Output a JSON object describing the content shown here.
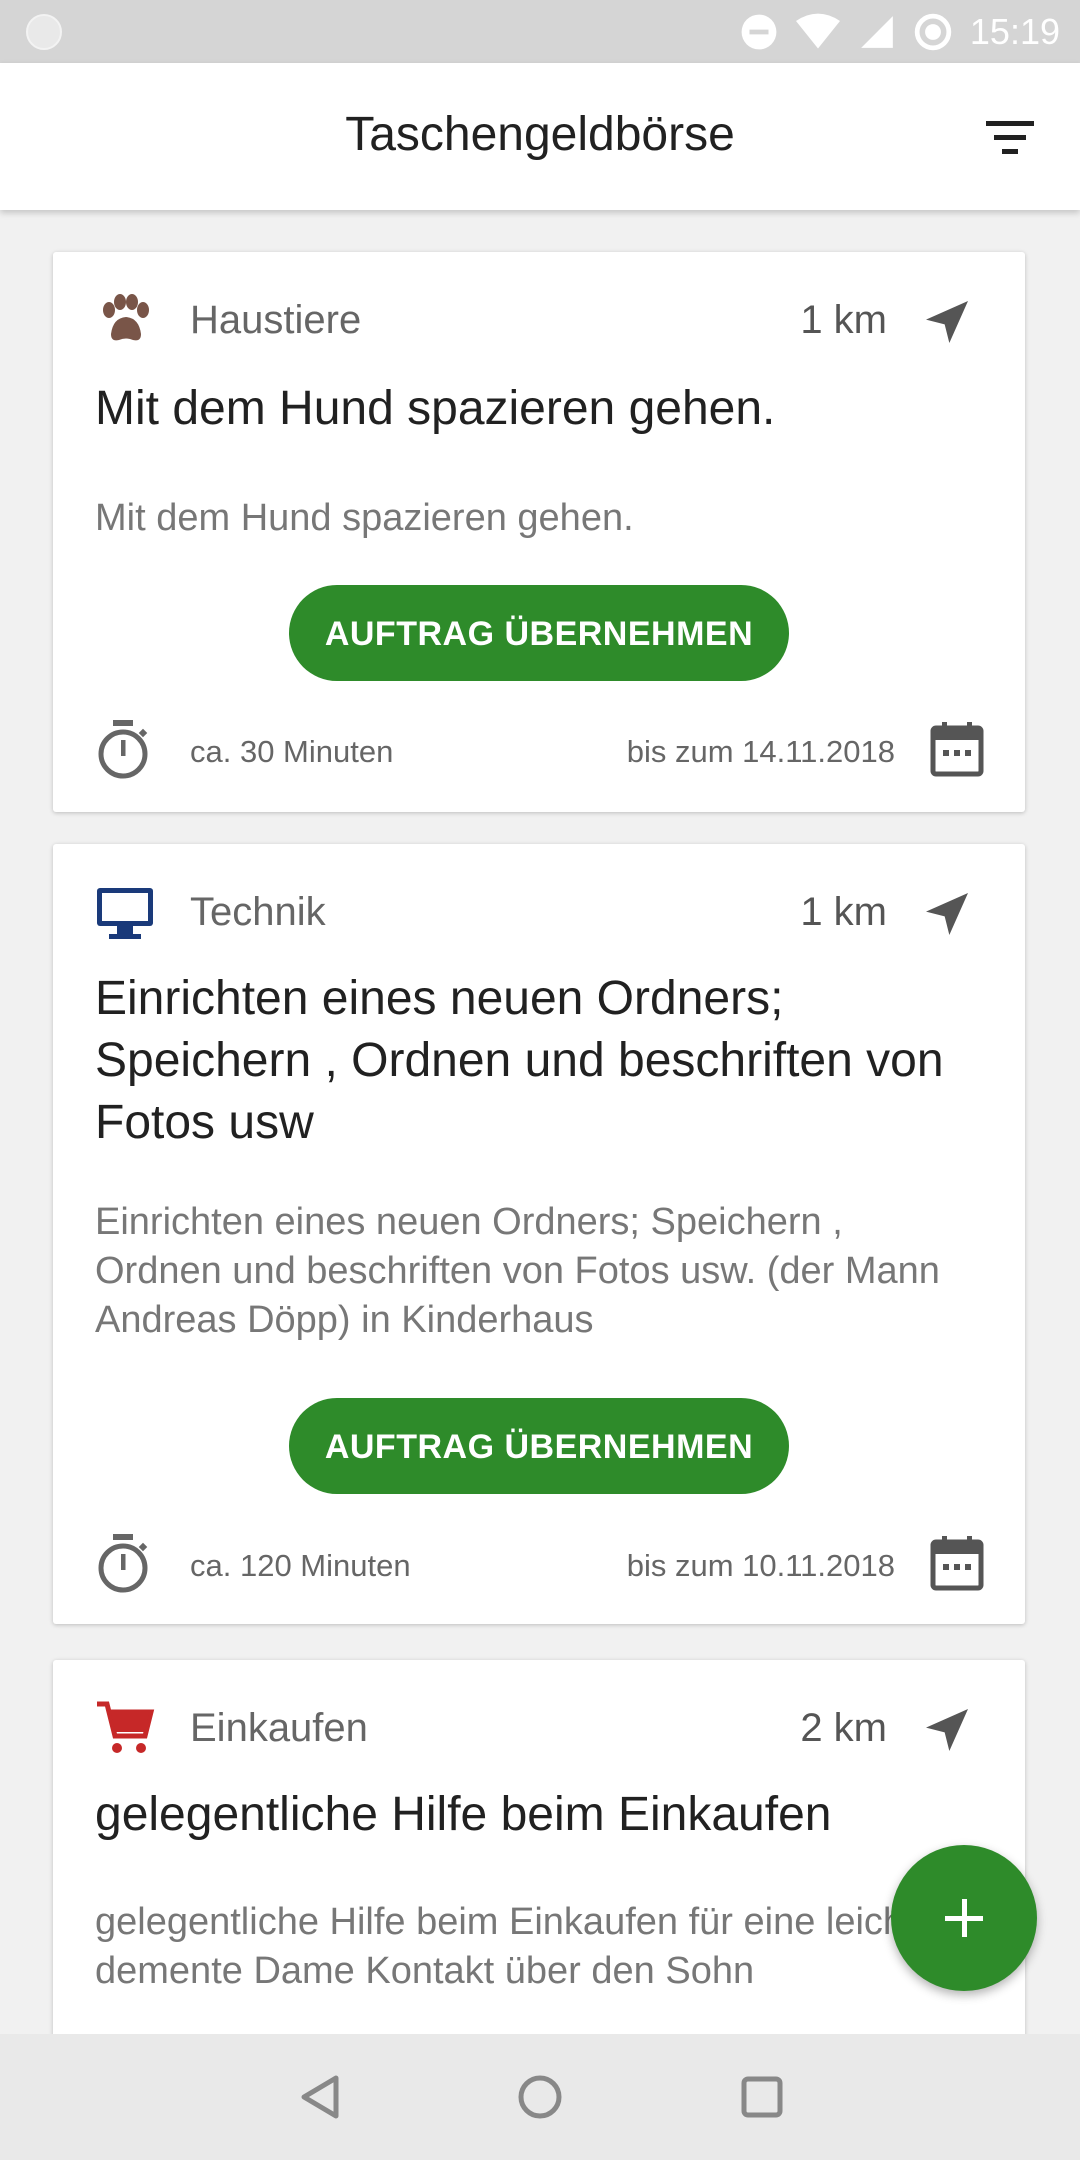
{
  "status_bar": {
    "time": "15:19"
  },
  "app_bar": {
    "title": "Taschengeldbörse",
    "filter_icon": "filter-icon"
  },
  "jobs": [
    {
      "category": "Haustiere",
      "category_icon": "paw-icon",
      "category_color": "#795548",
      "distance": "1 km",
      "title": "Mit dem Hund spazieren gehen.",
      "description": "Mit dem Hund spazieren gehen.",
      "button_label": "AUFTRAG ÜBERNEHMEN",
      "duration": "ca. 30 Minuten",
      "deadline": "bis zum 14.11.2018"
    },
    {
      "category": "Technik",
      "category_icon": "monitor-icon",
      "category_color": "#1a3a7a",
      "distance": "1 km",
      "title": "Einrichten eines neuen Ordners; Speichern , Ordnen und beschriften von Fotos usw",
      "description": "Einrichten eines neuen Ordners; Speichern , Ordnen und beschriften von Fotos usw. (der Mann Andreas Döpp) in Kinderhaus",
      "button_label": "AUFTRAG ÜBERNEHMEN",
      "duration": "ca. 120 Minuten",
      "deadline": "bis zum 10.11.2018"
    },
    {
      "category": "Einkaufen",
      "category_icon": "cart-icon",
      "category_color": "#c62828",
      "distance": "2 km",
      "title": "gelegentliche Hilfe beim Einkaufen",
      "description": "gelegentliche Hilfe beim Einkaufen für eine leicht demente Dame Kontakt über den Sohn"
    }
  ],
  "colors": {
    "accent": "#2e8b2a"
  }
}
